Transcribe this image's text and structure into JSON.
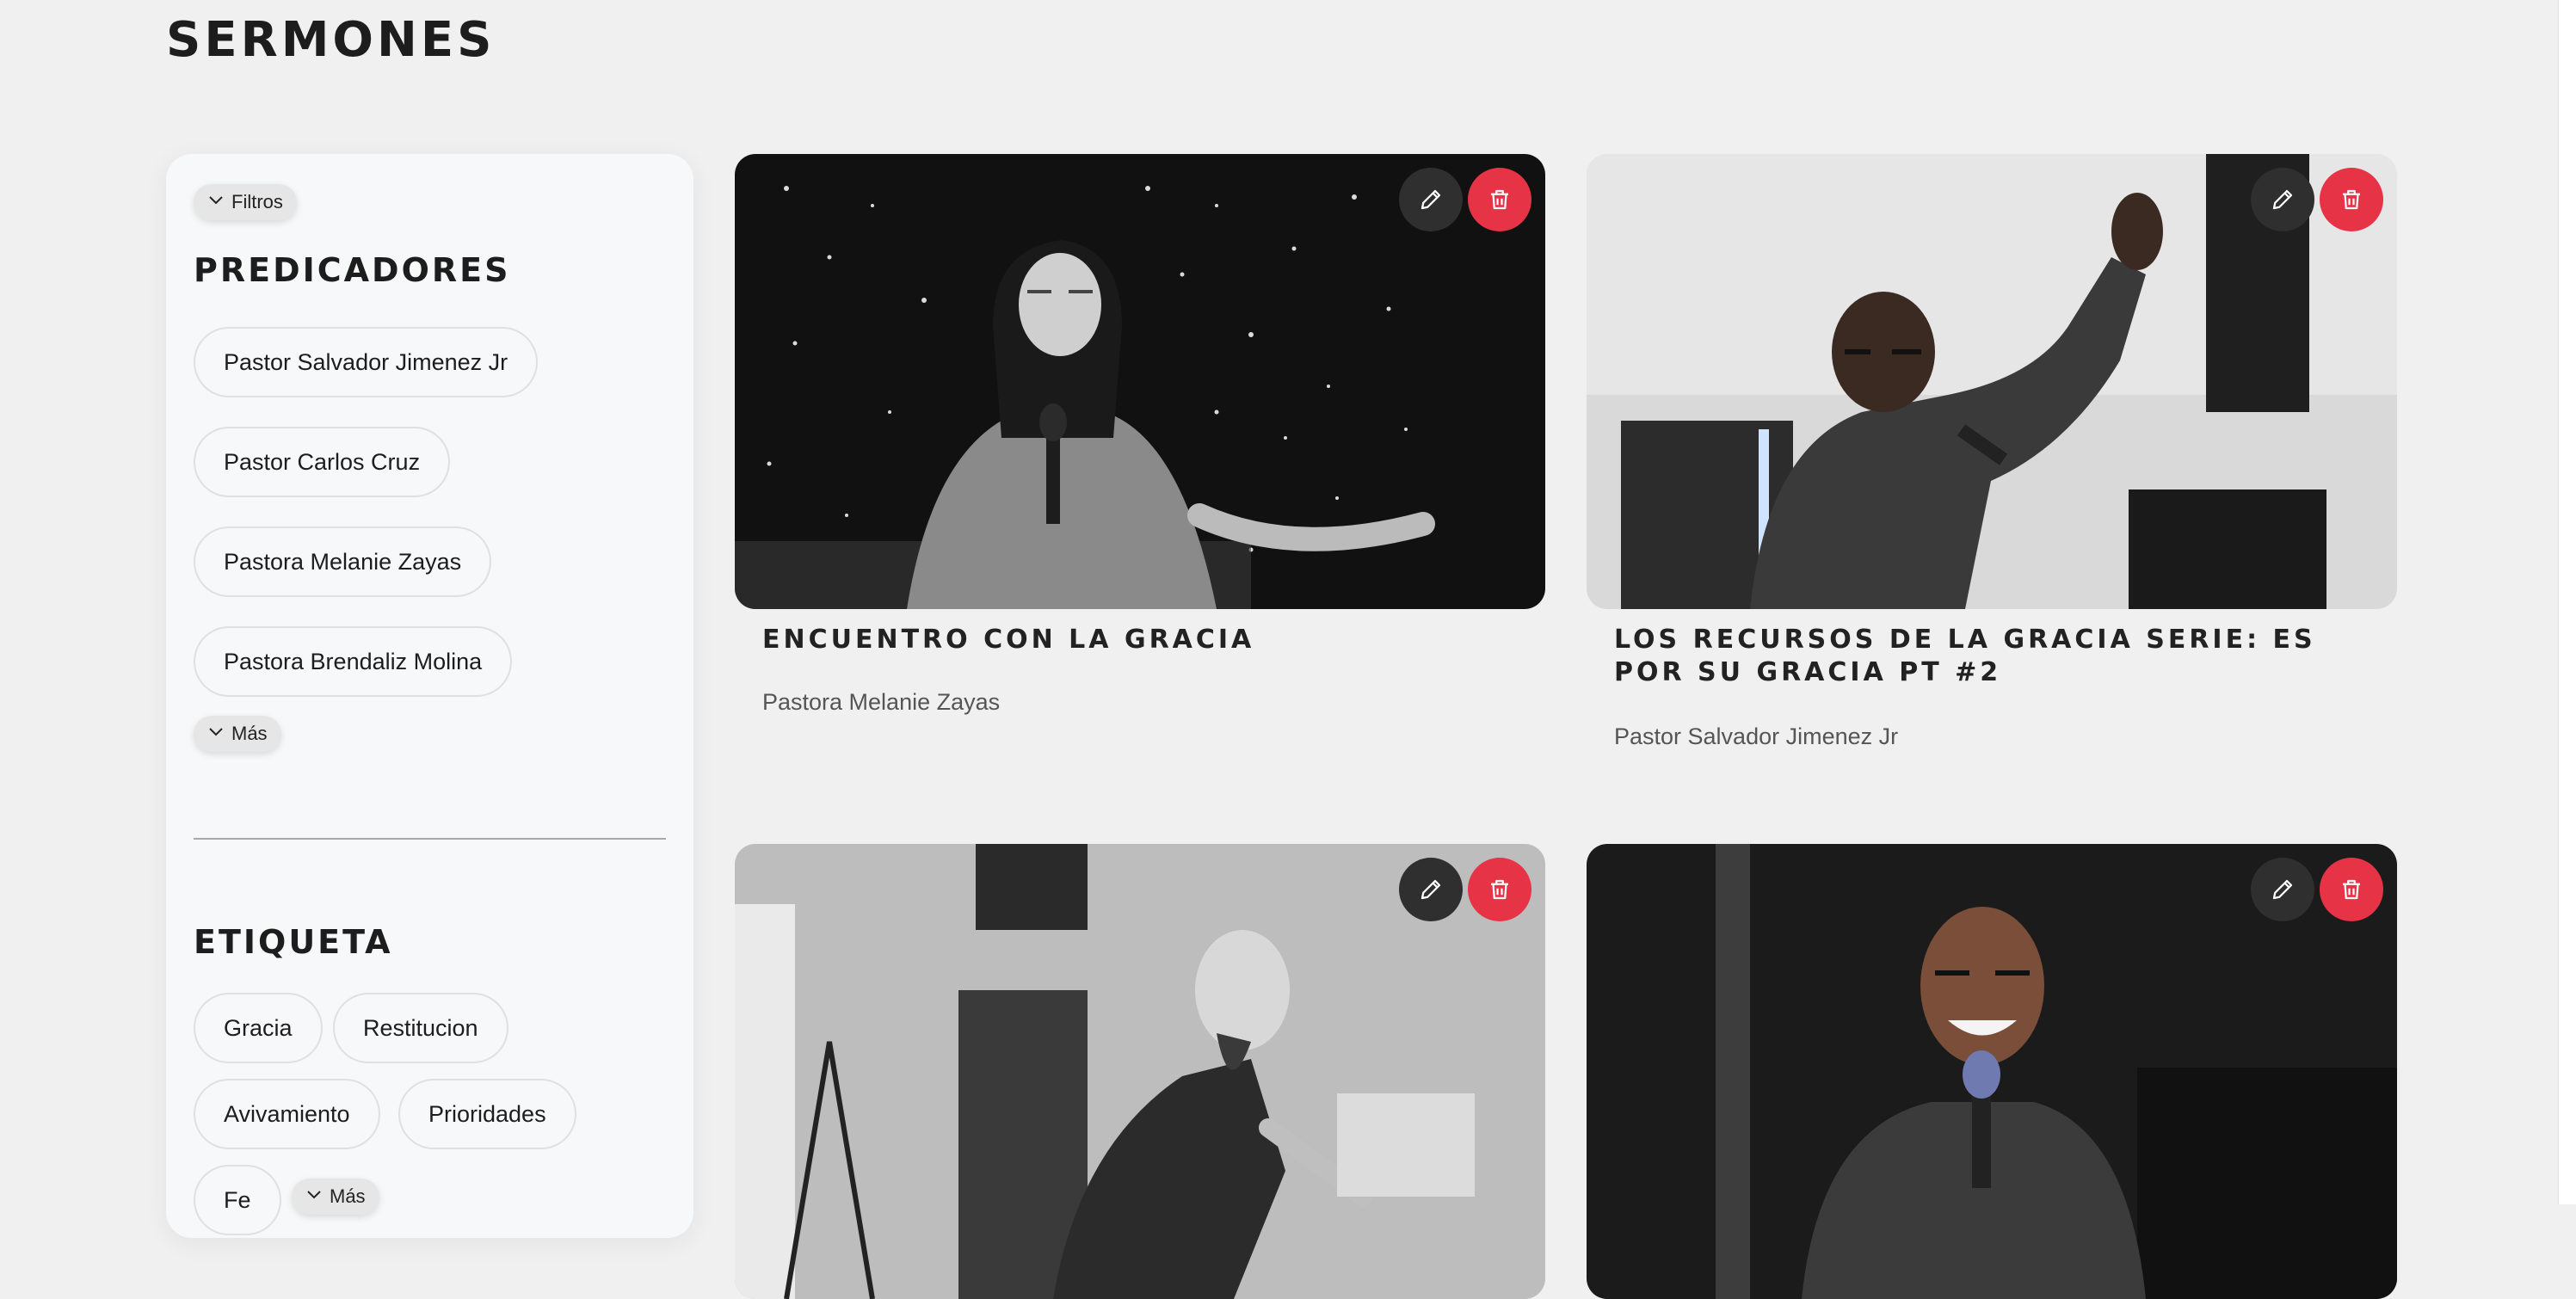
{
  "page": {
    "title": "SERMONES"
  },
  "sidebar": {
    "filters_toggle": "Filtros",
    "preachers_heading": "PREDICADORES",
    "preachers": [
      "Pastor Salvador Jimenez Jr",
      "Pastor Carlos Cruz",
      "Pastora Melanie Zayas",
      "Pastora Brendaliz Molina"
    ],
    "more_toggle": "Más",
    "tags_heading": "ETIQUETA",
    "tags": [
      "Gracia",
      "Restitucion",
      "Avivamiento",
      "Prioridades",
      "Fe"
    ],
    "tags_more_toggle": "Más"
  },
  "sermons": [
    {
      "title": "ENCUENTRO CON LA GRACIA",
      "preacher": "Pastora Melanie Zayas"
    },
    {
      "title": "LOS RECURSOS DE LA GRACIA SERIE: ES POR SU GRACIA PT #2",
      "preacher": "Pastor Salvador Jimenez Jr"
    },
    {
      "title": "",
      "preacher": ""
    },
    {
      "title": "",
      "preacher": ""
    }
  ],
  "colors": {
    "background": "#f0f0f0",
    "sidebar": "#f7f8f9",
    "edit_button": "#2f2f2f",
    "delete_button": "#e63346"
  },
  "icons": {
    "chevron": "chevron-down-icon",
    "edit": "pencil-icon",
    "delete": "trash-icon"
  }
}
